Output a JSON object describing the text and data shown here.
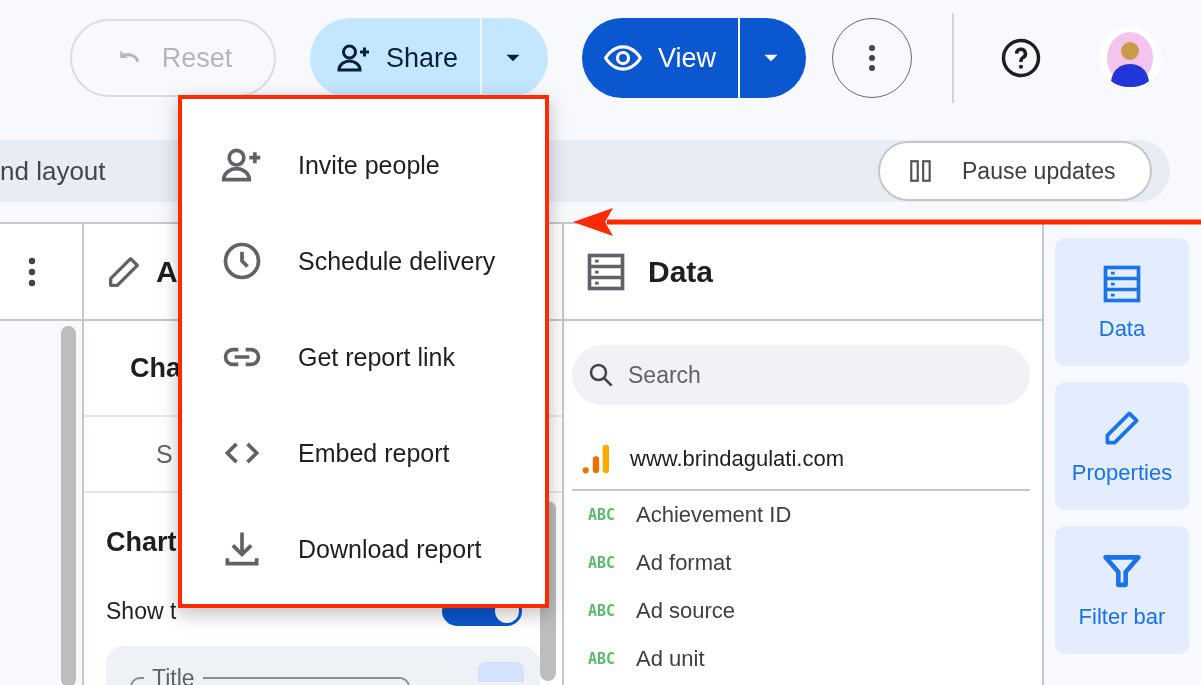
{
  "header": {
    "reset": {
      "label": "Reset",
      "disabled": true
    },
    "share": {
      "label": "Share"
    },
    "view": {
      "label": "View"
    }
  },
  "layout_bar": {
    "text": "nd layout",
    "pause_button": "Pause updates"
  },
  "properties_panel": {
    "title": "A",
    "chart_name": "Cha",
    "tab_label": "S",
    "section_title": "Chart",
    "show_title": {
      "label": "Show t",
      "on": true
    },
    "title_field": {
      "label": "Title"
    }
  },
  "data_panel": {
    "title": "Data",
    "search_placeholder": "Search",
    "source": "www.brindagulati.com",
    "fields": [
      {
        "type_label": "ABC",
        "name": "Achievement ID"
      },
      {
        "type_label": "ABC",
        "name": "Ad format"
      },
      {
        "type_label": "ABC",
        "name": "Ad source"
      },
      {
        "type_label": "ABC",
        "name": "Ad unit"
      }
    ]
  },
  "side_rail": [
    {
      "kind": "data",
      "label": "Data"
    },
    {
      "kind": "properties",
      "label": "Properties"
    },
    {
      "kind": "filter",
      "label": "Filter bar"
    }
  ],
  "share_menu": [
    {
      "kind": "invite",
      "label": "Invite people"
    },
    {
      "kind": "schedule",
      "label": "Schedule delivery"
    },
    {
      "kind": "link",
      "label": "Get report link"
    },
    {
      "kind": "embed",
      "label": "Embed report"
    },
    {
      "kind": "download",
      "label": "Download report"
    }
  ]
}
